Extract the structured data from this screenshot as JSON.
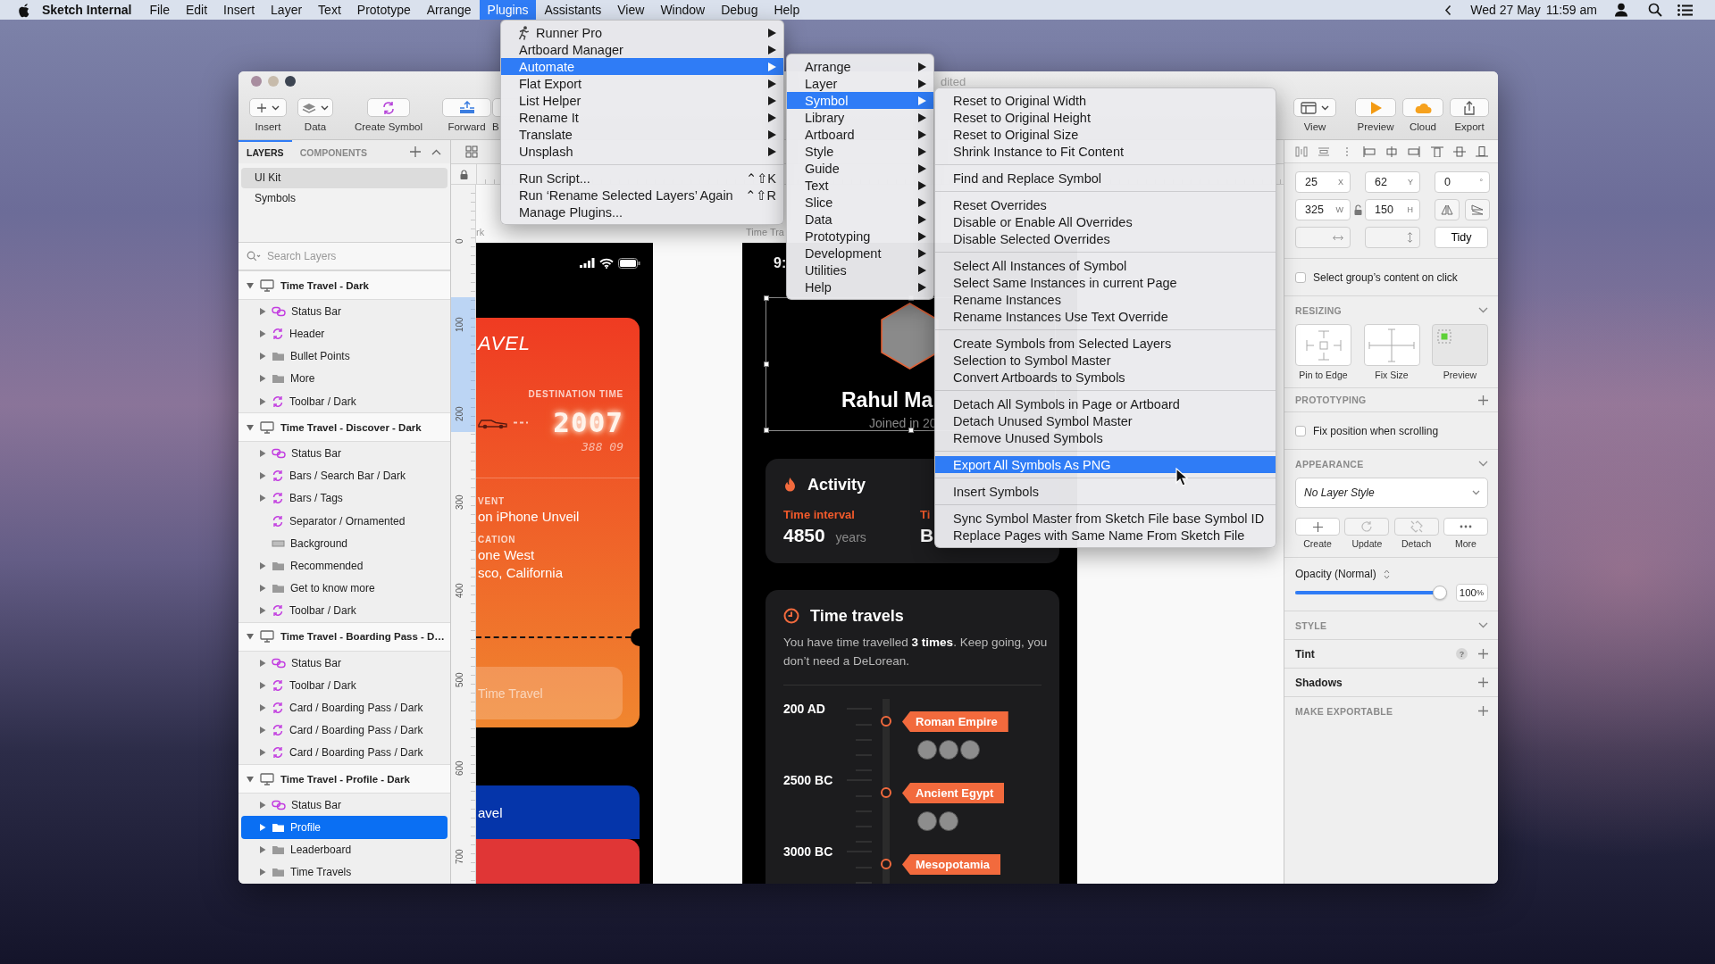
{
  "menu_bar": {
    "app_name": "Sketch Internal",
    "items": [
      {
        "label": "File",
        "selected": false
      },
      {
        "label": "Edit",
        "selected": false
      },
      {
        "label": "Insert",
        "selected": false
      },
      {
        "label": "Layer",
        "selected": false
      },
      {
        "label": "Text",
        "selected": false
      },
      {
        "label": "Prototype",
        "selected": false
      },
      {
        "label": "Arrange",
        "selected": false
      },
      {
        "label": "Plugins",
        "selected": true
      },
      {
        "label": "Assistants",
        "selected": false
      },
      {
        "label": "View",
        "selected": false
      },
      {
        "label": "Window",
        "selected": false
      },
      {
        "label": "Debug",
        "selected": false
      },
      {
        "label": "Help",
        "selected": false
      }
    ],
    "date": "Wed 27 May",
    "time": "11:59 am"
  },
  "window": {
    "title": "dited",
    "toolbar_left": [
      {
        "label": "Insert",
        "kind": "insert"
      },
      {
        "label": "Data",
        "kind": "data"
      },
      {
        "label": "Create Symbol",
        "kind": "create-symbol"
      },
      {
        "label": "Forward",
        "kind": "forward"
      },
      {
        "label": "B",
        "kind": "covered"
      }
    ],
    "toolbar_right": [
      {
        "label": "View",
        "kind": "view"
      },
      {
        "label": "Preview",
        "kind": "preview"
      },
      {
        "label": "Cloud",
        "kind": "cloud"
      },
      {
        "label": "Export",
        "kind": "export"
      }
    ]
  },
  "layers_panel": {
    "tabs": [
      {
        "label": "LAYERS",
        "selected": true
      },
      {
        "label": "COMPONENTS",
        "selected": false
      }
    ],
    "pages": [
      {
        "label": "UI Kit",
        "selected": true
      },
      {
        "label": "Symbols",
        "selected": false
      }
    ],
    "search": {
      "placeholder": "Search Layers"
    },
    "layers": [
      {
        "name": "Time Travel - Dark",
        "kind": "artboard",
        "collapsible": true,
        "expanded": true,
        "selected": false,
        "children": [
          {
            "name": "Status Bar",
            "kind": "symbol-link",
            "collapsible": true,
            "expanded": false,
            "selected": false
          },
          {
            "name": "Header",
            "kind": "symbol",
            "collapsible": true,
            "expanded": false,
            "selected": false
          },
          {
            "name": "Bullet Points",
            "kind": "group",
            "collapsible": true,
            "expanded": false,
            "selected": false
          },
          {
            "name": "More",
            "kind": "group",
            "collapsible": true,
            "expanded": false,
            "selected": false
          },
          {
            "name": "Toolbar / Dark",
            "kind": "symbol",
            "collapsible": true,
            "expanded": false,
            "selected": false
          }
        ]
      },
      {
        "name": "Time Travel - Discover - Dark",
        "kind": "artboard",
        "collapsible": true,
        "expanded": true,
        "selected": false,
        "children": [
          {
            "name": "Status Bar",
            "kind": "symbol-link",
            "collapsible": true,
            "expanded": false,
            "selected": false
          },
          {
            "name": "Bars / Search Bar / Dark",
            "kind": "symbol",
            "collapsible": true,
            "expanded": false,
            "selected": false
          },
          {
            "name": "Bars / Tags",
            "kind": "symbol",
            "collapsible": true,
            "expanded": false,
            "selected": false
          },
          {
            "name": "Separator / Ornamented",
            "kind": "symbol",
            "collapsible": false,
            "selected": false
          },
          {
            "name": "Background",
            "kind": "shape",
            "collapsible": false,
            "selected": false
          },
          {
            "name": "Recommended",
            "kind": "group",
            "collapsible": true,
            "expanded": false,
            "selected": false
          },
          {
            "name": "Get to know more",
            "kind": "group",
            "collapsible": true,
            "expanded": false,
            "selected": false
          },
          {
            "name": "Toolbar / Dark",
            "kind": "symbol",
            "collapsible": true,
            "expanded": false,
            "selected": false
          }
        ]
      },
      {
        "name": "Time Travel - Boarding Pass - D…",
        "kind": "artboard",
        "collapsible": true,
        "expanded": true,
        "selected": false,
        "children": [
          {
            "name": "Status Bar",
            "kind": "symbol-link",
            "collapsible": true,
            "expanded": false,
            "selected": false
          },
          {
            "name": "Toolbar / Dark",
            "kind": "symbol",
            "collapsible": true,
            "expanded": false,
            "selected": false
          },
          {
            "name": "Card / Boarding Pass / Dark",
            "kind": "symbol",
            "collapsible": true,
            "expanded": false,
            "selected": false
          },
          {
            "name": "Card / Boarding Pass / Dark",
            "kind": "symbol",
            "collapsible": true,
            "expanded": false,
            "selected": false
          },
          {
            "name": "Card / Boarding Pass / Dark",
            "kind": "symbol",
            "collapsible": true,
            "expanded": false,
            "selected": false
          }
        ]
      },
      {
        "name": "Time Travel - Profile - Dark",
        "kind": "artboard",
        "collapsible": true,
        "expanded": true,
        "selected": false,
        "children": [
          {
            "name": "Status Bar",
            "kind": "symbol-link",
            "collapsible": true,
            "expanded": false,
            "selected": false
          },
          {
            "name": "Profile",
            "kind": "group",
            "collapsible": true,
            "expanded": false,
            "selected": true
          },
          {
            "name": "Leaderboard",
            "kind": "group",
            "collapsible": true,
            "expanded": false,
            "selected": false
          },
          {
            "name": "Time Travels",
            "kind": "group",
            "collapsible": true,
            "expanded": false,
            "selected": false
          }
        ]
      }
    ]
  },
  "canvas": {
    "ruler_marks": [
      "0",
      "100",
      "200",
      "300",
      "400",
      "500",
      "600",
      "700"
    ],
    "boarding_pass": {
      "label": "rk",
      "heading": "AVEL",
      "destination_label": "DESTINATION TIME",
      "year": "2007",
      "clock": "388 09",
      "event_label": "VENT",
      "event": "on iPhone Unveil",
      "location_label": "CATION",
      "location_lines": [
        "one West",
        "sco, California"
      ],
      "button": "Time Travel",
      "next_card": "avel"
    },
    "profile": {
      "label": "Time Tra",
      "status_time": "9:",
      "name": "Rahul Ma",
      "joined": "Joined in 20",
      "activity": {
        "title": "Activity",
        "stats": [
          {
            "label": "Time interval",
            "value": "4850",
            "unit": "years"
          },
          {
            "label": "Ti",
            "value": "B"
          }
        ]
      },
      "travels": {
        "title": "Time travels",
        "text": "You have time travelled **3 times**. Keep going, you don’t need a DeLorean.",
        "entries": [
          {
            "date": "200 AD",
            "place": "Roman Empire",
            "travellers": [
              {
                "kind": "photo"
              },
              {
                "kind": "photo"
              },
              {
                "kind": "photo"
              }
            ]
          },
          {
            "date": "2500 BC",
            "place": "Ancient Egypt",
            "travellers": [
              {
                "kind": "photo"
              },
              {
                "kind": "photo"
              }
            ]
          },
          {
            "date": "3000 BC",
            "place": "Mesopotamia"
          }
        ]
      }
    }
  },
  "inspector": {
    "fields": [
      {
        "value": "25",
        "unit": "X"
      },
      {
        "value": "62",
        "unit": "Y"
      },
      {
        "value": "0",
        "unit": "°"
      },
      {
        "value": "325",
        "unit": "W"
      },
      {
        "value": "150",
        "unit": "H"
      }
    ],
    "spacing_fields": [
      {
        "kind": "horizontal",
        "disabled": true
      },
      {
        "kind": "vertical",
        "disabled": true
      }
    ],
    "tidy": "Tidy",
    "group_select": {
      "label": "Select group’s content on click",
      "checked": false
    },
    "resizing": {
      "title": "RESIZING",
      "options": [
        {
          "label": "Pin to Edge",
          "kind": "pin"
        },
        {
          "label": "Fix Size",
          "kind": "fix"
        },
        {
          "label": "Preview",
          "kind": "preview"
        }
      ]
    },
    "prototyping": {
      "title": "PROTOTYPING",
      "fix_position": {
        "label": "Fix position when scrolling",
        "checked": false
      }
    },
    "appearance": {
      "title": "APPEARANCE",
      "layer_style": "No Layer Style",
      "actions": [
        {
          "label": "Create",
          "kind": "create",
          "disabled": false
        },
        {
          "label": "Update",
          "kind": "update",
          "disabled": true
        },
        {
          "label": "Detach",
          "kind": "detach",
          "disabled": true
        },
        {
          "label": "More",
          "kind": "more",
          "disabled": false
        }
      ],
      "opacity_label": "Opacity (Normal)",
      "opacity": {
        "level": 1
      },
      "opacity_value": "100",
      "opacity_unit": "%"
    },
    "style": {
      "title": "STYLE",
      "rows": [
        {
          "label": "Tint",
          "help": "?"
        },
        {
          "label": "Shadows"
        }
      ]
    },
    "export": {
      "title": "MAKE EXPORTABLE"
    }
  },
  "plugins_menu": {
    "groups": [
      {
        "items": [
          {
            "label": "Runner Pro",
            "kind": "runner",
            "submenu": true,
            "selected": false
          },
          {
            "label": "Artboard Manager",
            "submenu": true,
            "selected": false
          },
          {
            "label": "Automate",
            "submenu": true,
            "selected": true
          },
          {
            "label": "Flat Export",
            "submenu": true,
            "selected": false
          },
          {
            "label": "List Helper",
            "submenu": true,
            "selected": false
          },
          {
            "label": "Rename It",
            "submenu": true,
            "selected": false
          },
          {
            "label": "Translate",
            "submenu": true,
            "selected": false
          },
          {
            "label": "Unsplash",
            "submenu": true,
            "selected": false
          }
        ]
      },
      {
        "items": [
          {
            "label": "Run Script...",
            "shortcut": "⌃⇧K",
            "submenu": false,
            "selected": false
          },
          {
            "label": "Run ‘Rename Selected Layers’ Again",
            "shortcut": "⌃⇧R",
            "submenu": false,
            "selected": false
          },
          {
            "label": "Manage Plugins...",
            "submenu": false,
            "selected": false
          }
        ]
      }
    ]
  },
  "automate_menu": {
    "groups": [
      {
        "items": [
          {
            "label": "Arrange",
            "submenu": true,
            "selected": false
          },
          {
            "label": "Layer",
            "submenu": true,
            "selected": false
          },
          {
            "label": "Symbol",
            "submenu": true,
            "selected": true
          },
          {
            "label": "Library",
            "submenu": true,
            "selected": false
          },
          {
            "label": "Artboard",
            "submenu": true,
            "selected": false
          },
          {
            "label": "Style",
            "submenu": true,
            "selected": false
          },
          {
            "label": "Guide",
            "submenu": true,
            "selected": false
          },
          {
            "label": "Text",
            "submenu": true,
            "selected": false
          },
          {
            "label": "Slice",
            "submenu": true,
            "selected": false
          },
          {
            "label": "Data",
            "submenu": true,
            "selected": false
          },
          {
            "label": "Prototyping",
            "submenu": true,
            "selected": false
          },
          {
            "label": "Development",
            "submenu": true,
            "selected": false
          },
          {
            "label": "Utilities",
            "submenu": true,
            "selected": false
          },
          {
            "label": "Help",
            "submenu": true,
            "selected": false
          }
        ]
      }
    ]
  },
  "symbol_menu": {
    "groups": [
      {
        "items": [
          {
            "label": "Reset to Original Width",
            "submenu": false,
            "selected": false
          },
          {
            "label": "Reset to Original Height",
            "submenu": false,
            "selected": false
          },
          {
            "label": "Reset to Original Size",
            "submenu": false,
            "selected": false
          },
          {
            "label": "Shrink Instance to Fit Content",
            "submenu": false,
            "selected": false
          }
        ]
      },
      {
        "items": [
          {
            "label": "Find and Replace Symbol",
            "submenu": false,
            "selected": false
          }
        ]
      },
      {
        "items": [
          {
            "label": "Reset Overrides",
            "submenu": false,
            "selected": false
          },
          {
            "label": "Disable or Enable All Overrides",
            "submenu": false,
            "selected": false
          },
          {
            "label": "Disable Selected Overrides",
            "submenu": false,
            "selected": false
          }
        ]
      },
      {
        "items": [
          {
            "label": "Select All Instances of Symbol",
            "submenu": false,
            "selected": false
          },
          {
            "label": "Select Same Instances in current Page",
            "submenu": false,
            "selected": false
          },
          {
            "label": "Rename Instances",
            "submenu": false,
            "selected": false
          },
          {
            "label": "Rename Instances Use Text Override",
            "submenu": false,
            "selected": false
          }
        ]
      },
      {
        "items": [
          {
            "label": "Create Symbols from Selected Layers",
            "submenu": false,
            "selected": false
          },
          {
            "label": "Selection to Symbol Master",
            "submenu": false,
            "selected": false
          },
          {
            "label": "Convert Artboards to Symbols",
            "submenu": false,
            "selected": false
          }
        ]
      },
      {
        "items": [
          {
            "label": "Detach All Symbols in Page or Artboard",
            "submenu": false,
            "selected": false
          },
          {
            "label": "Detach Unused Symbol Master",
            "submenu": false,
            "selected": false
          },
          {
            "label": "Remove Unused Symbols",
            "submenu": false,
            "selected": false
          }
        ]
      },
      {
        "items": [
          {
            "label": "Export All Symbols As PNG",
            "submenu": false,
            "selected": true
          }
        ]
      },
      {
        "items": [
          {
            "label": "Insert Symbols",
            "submenu": false,
            "selected": false
          }
        ]
      },
      {
        "items": [
          {
            "label": "Sync Symbol Master from Sketch File base Symbol ID",
            "submenu": false,
            "selected": false
          },
          {
            "label": "Replace Pages with Same Name From Sketch File",
            "submenu": false,
            "selected": false
          }
        ]
      }
    ]
  }
}
